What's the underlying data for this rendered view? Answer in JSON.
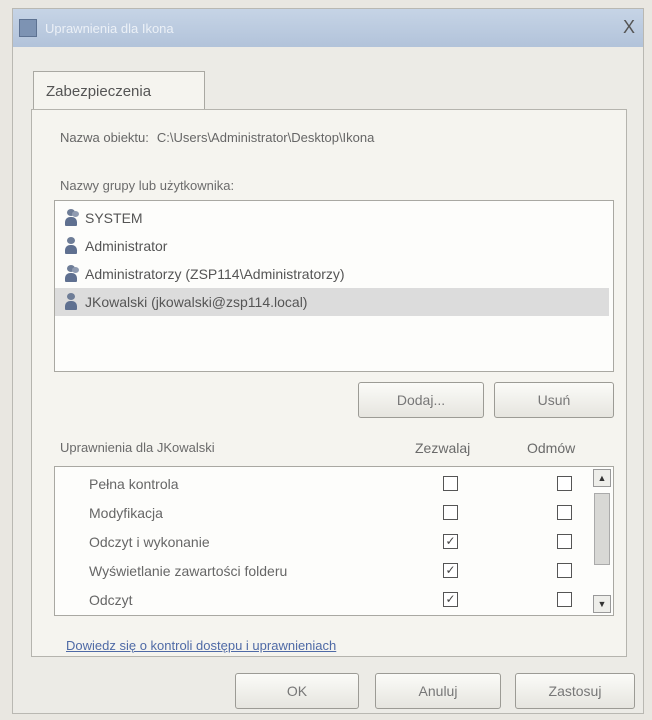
{
  "window": {
    "title": "Uprawnienia dla Ikona",
    "close_glyph": "X"
  },
  "tab": {
    "label": "Zabezpieczenia"
  },
  "object": {
    "label": "Nazwa obiektu:",
    "path": "C:\\Users\\Administrator\\Desktop\\Ikona"
  },
  "groups": {
    "label": "Nazwy grupy lub użytkownika:",
    "items": [
      {
        "name": "SYSTEM",
        "icon": "group-icon"
      },
      {
        "name": "Administrator",
        "icon": "user-icon"
      },
      {
        "name": "Administratorzy (ZSP114\\Administratorzy)",
        "icon": "group-icon"
      },
      {
        "name": "JKowalski (jkowalski@zsp114.local)",
        "icon": "user-icon",
        "selected": true
      }
    ]
  },
  "buttons": {
    "add": "Dodaj...",
    "remove": "Usuń"
  },
  "permissions": {
    "label": "Uprawnienia dla JKowalski",
    "allow_header": "Zezwalaj",
    "deny_header": "Odmów",
    "rows": [
      {
        "name": "Pełna kontrola",
        "allow": false,
        "deny": false
      },
      {
        "name": "Modyfikacja",
        "allow": false,
        "deny": false
      },
      {
        "name": "Odczyt i wykonanie",
        "allow": true,
        "deny": false
      },
      {
        "name": "Wyświetlanie zawartości folderu",
        "allow": true,
        "deny": false
      },
      {
        "name": "Odczyt",
        "allow": true,
        "deny": false
      }
    ]
  },
  "link": {
    "text": "Dowiedz się o kontroli dostępu i uprawnieniach"
  },
  "footer": {
    "ok": "OK",
    "cancel": "Anuluj",
    "apply": "Zastosuj"
  },
  "colors": {
    "selection": "#dcdcdc",
    "link": "#4f6aa6",
    "titlebar": "#b8c8dd"
  }
}
